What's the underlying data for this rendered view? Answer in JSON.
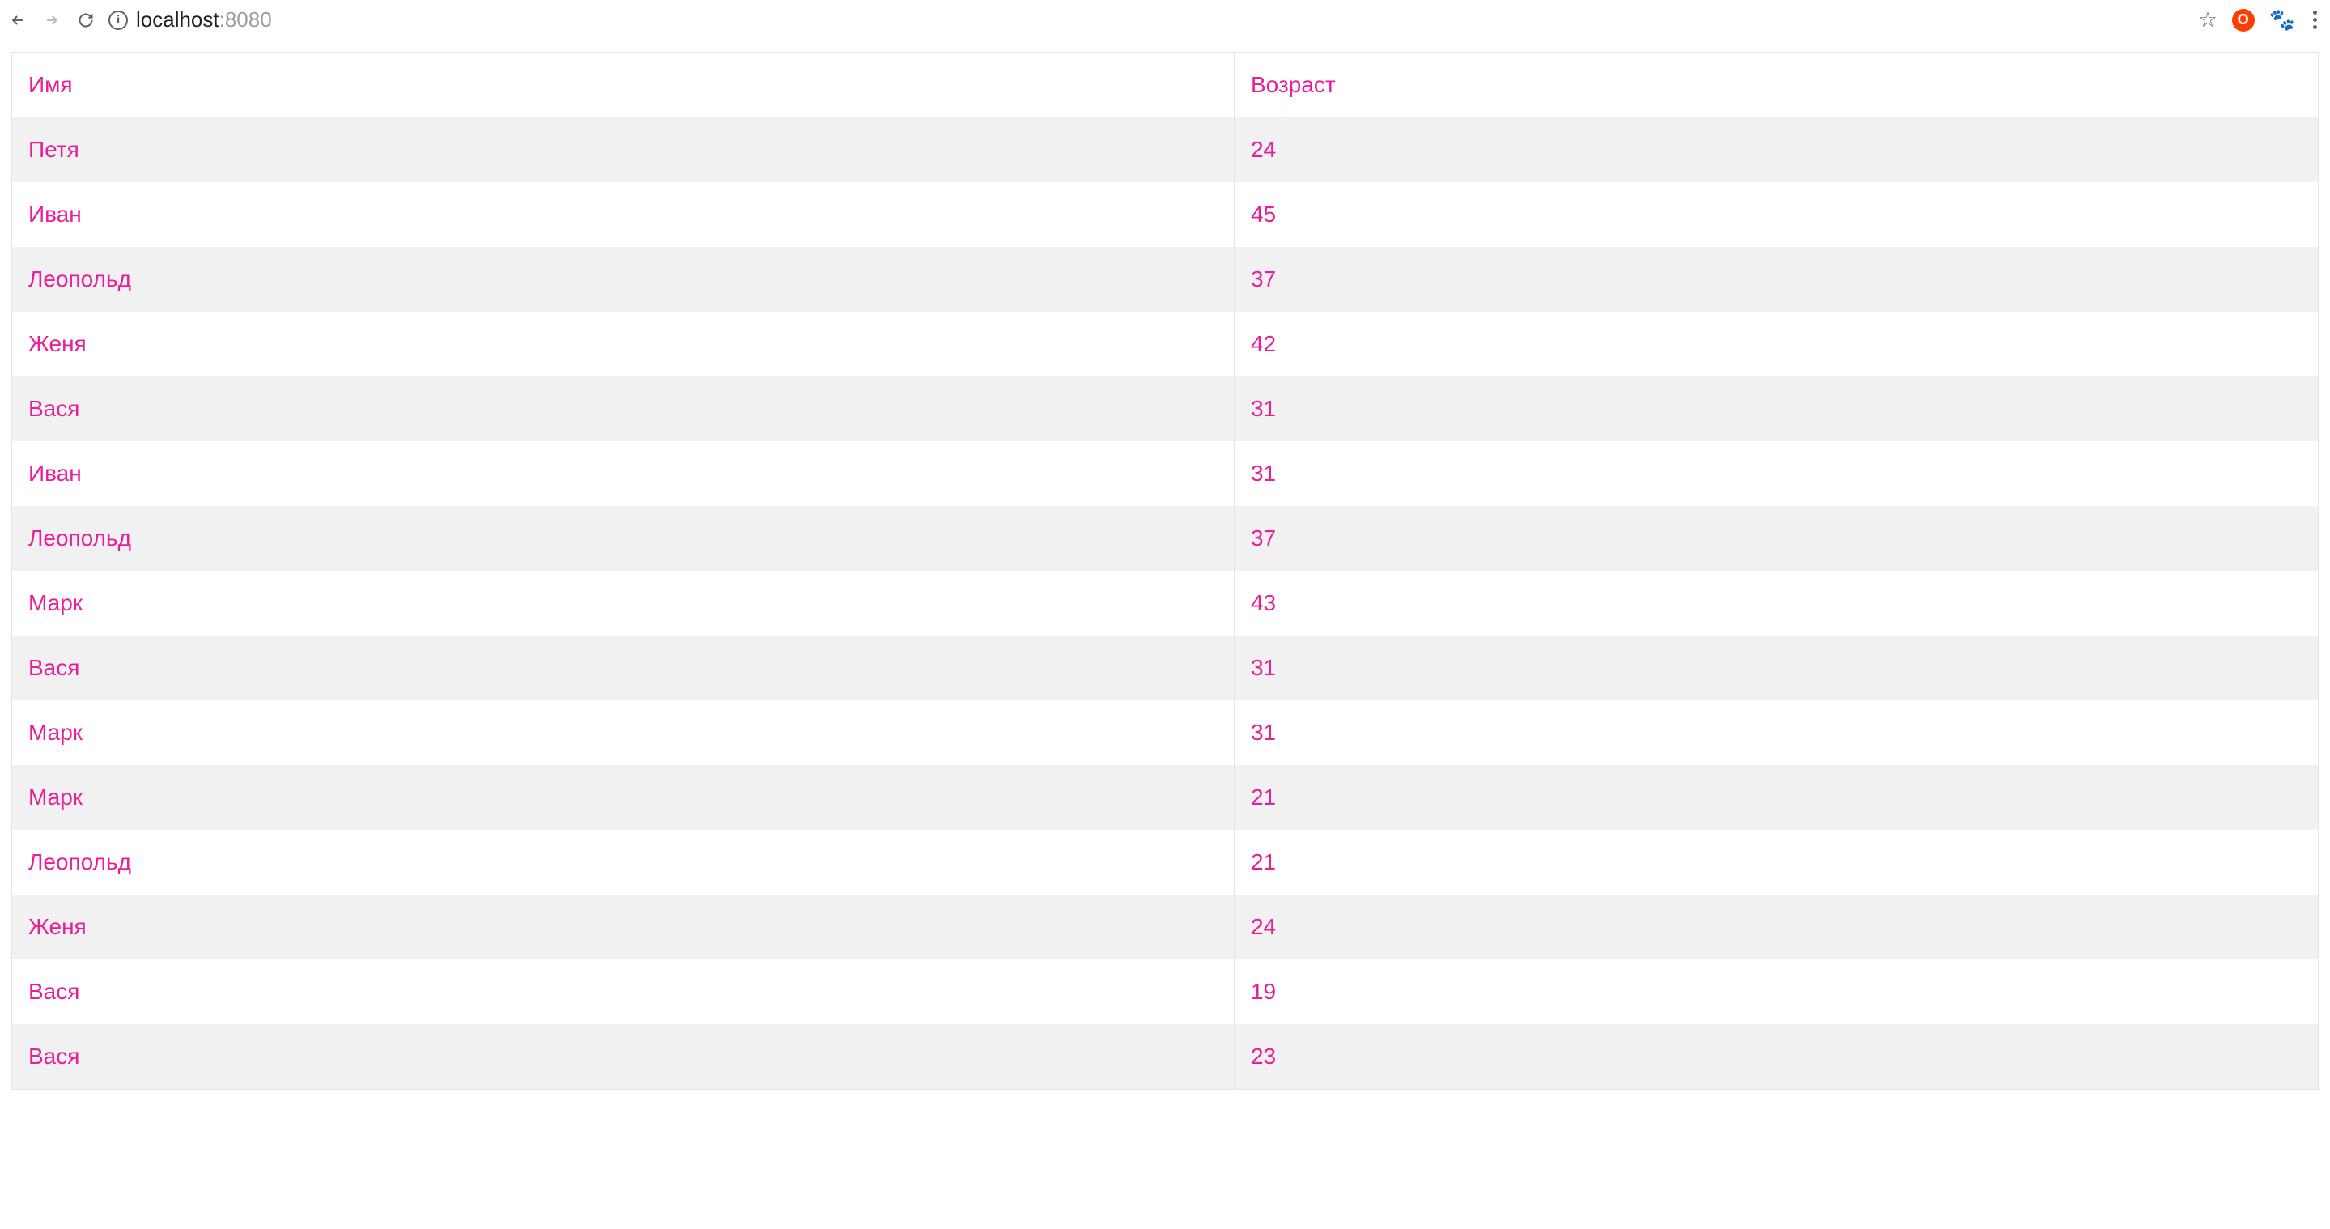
{
  "browser": {
    "url_host": "localhost",
    "url_port": ":8080",
    "extension_letter": "O"
  },
  "table": {
    "headers": {
      "name": "Имя",
      "age": "Возраст"
    },
    "rows": [
      {
        "name": "Петя",
        "age": "24"
      },
      {
        "name": "Иван",
        "age": "45"
      },
      {
        "name": "Леопольд",
        "age": "37"
      },
      {
        "name": "Женя",
        "age": "42"
      },
      {
        "name": "Вася",
        "age": "31"
      },
      {
        "name": "Иван",
        "age": "31"
      },
      {
        "name": "Леопольд",
        "age": "37"
      },
      {
        "name": "Марк",
        "age": "43"
      },
      {
        "name": "Вася",
        "age": "31"
      },
      {
        "name": "Марк",
        "age": "31"
      },
      {
        "name": "Марк",
        "age": "21"
      },
      {
        "name": "Леопольд",
        "age": "21"
      },
      {
        "name": "Женя",
        "age": "24"
      },
      {
        "name": "Вася",
        "age": "19"
      },
      {
        "name": "Вася",
        "age": "23"
      }
    ]
  },
  "colors": {
    "accent": "#e91e99",
    "stripe": "#f1f1f1",
    "border": "#e5e5e5"
  }
}
